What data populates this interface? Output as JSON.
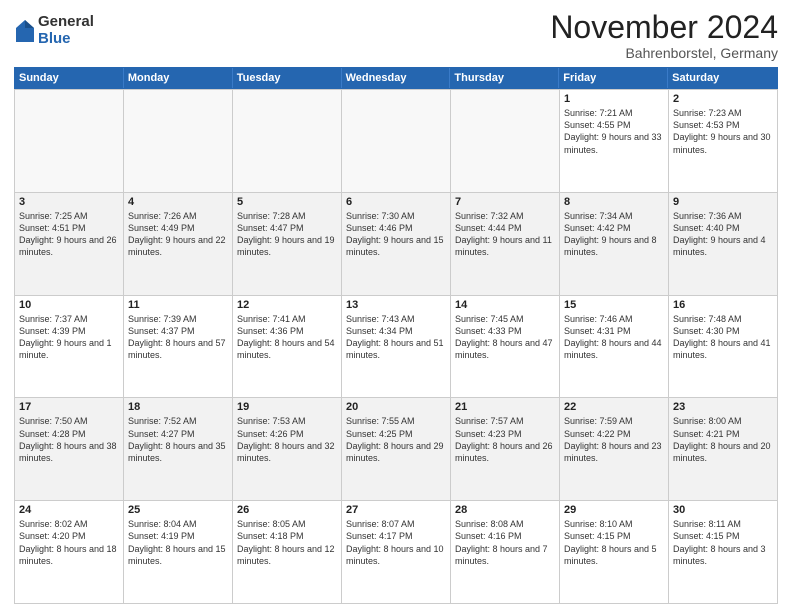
{
  "logo": {
    "general": "General",
    "blue": "Blue"
  },
  "title": "November 2024",
  "location": "Bahrenborstel, Germany",
  "header_days": [
    "Sunday",
    "Monday",
    "Tuesday",
    "Wednesday",
    "Thursday",
    "Friday",
    "Saturday"
  ],
  "weeks": [
    [
      {
        "day": "",
        "empty": true
      },
      {
        "day": "",
        "empty": true
      },
      {
        "day": "",
        "empty": true
      },
      {
        "day": "",
        "empty": true
      },
      {
        "day": "",
        "empty": true
      },
      {
        "day": "1",
        "sunrise": "Sunrise: 7:21 AM",
        "sunset": "Sunset: 4:55 PM",
        "daylight": "Daylight: 9 hours and 33 minutes."
      },
      {
        "day": "2",
        "sunrise": "Sunrise: 7:23 AM",
        "sunset": "Sunset: 4:53 PM",
        "daylight": "Daylight: 9 hours and 30 minutes."
      }
    ],
    [
      {
        "day": "3",
        "sunrise": "Sunrise: 7:25 AM",
        "sunset": "Sunset: 4:51 PM",
        "daylight": "Daylight: 9 hours and 26 minutes."
      },
      {
        "day": "4",
        "sunrise": "Sunrise: 7:26 AM",
        "sunset": "Sunset: 4:49 PM",
        "daylight": "Daylight: 9 hours and 22 minutes."
      },
      {
        "day": "5",
        "sunrise": "Sunrise: 7:28 AM",
        "sunset": "Sunset: 4:47 PM",
        "daylight": "Daylight: 9 hours and 19 minutes."
      },
      {
        "day": "6",
        "sunrise": "Sunrise: 7:30 AM",
        "sunset": "Sunset: 4:46 PM",
        "daylight": "Daylight: 9 hours and 15 minutes."
      },
      {
        "day": "7",
        "sunrise": "Sunrise: 7:32 AM",
        "sunset": "Sunset: 4:44 PM",
        "daylight": "Daylight: 9 hours and 11 minutes."
      },
      {
        "day": "8",
        "sunrise": "Sunrise: 7:34 AM",
        "sunset": "Sunset: 4:42 PM",
        "daylight": "Daylight: 9 hours and 8 minutes."
      },
      {
        "day": "9",
        "sunrise": "Sunrise: 7:36 AM",
        "sunset": "Sunset: 4:40 PM",
        "daylight": "Daylight: 9 hours and 4 minutes."
      }
    ],
    [
      {
        "day": "10",
        "sunrise": "Sunrise: 7:37 AM",
        "sunset": "Sunset: 4:39 PM",
        "daylight": "Daylight: 9 hours and 1 minute."
      },
      {
        "day": "11",
        "sunrise": "Sunrise: 7:39 AM",
        "sunset": "Sunset: 4:37 PM",
        "daylight": "Daylight: 8 hours and 57 minutes."
      },
      {
        "day": "12",
        "sunrise": "Sunrise: 7:41 AM",
        "sunset": "Sunset: 4:36 PM",
        "daylight": "Daylight: 8 hours and 54 minutes."
      },
      {
        "day": "13",
        "sunrise": "Sunrise: 7:43 AM",
        "sunset": "Sunset: 4:34 PM",
        "daylight": "Daylight: 8 hours and 51 minutes."
      },
      {
        "day": "14",
        "sunrise": "Sunrise: 7:45 AM",
        "sunset": "Sunset: 4:33 PM",
        "daylight": "Daylight: 8 hours and 47 minutes."
      },
      {
        "day": "15",
        "sunrise": "Sunrise: 7:46 AM",
        "sunset": "Sunset: 4:31 PM",
        "daylight": "Daylight: 8 hours and 44 minutes."
      },
      {
        "day": "16",
        "sunrise": "Sunrise: 7:48 AM",
        "sunset": "Sunset: 4:30 PM",
        "daylight": "Daylight: 8 hours and 41 minutes."
      }
    ],
    [
      {
        "day": "17",
        "sunrise": "Sunrise: 7:50 AM",
        "sunset": "Sunset: 4:28 PM",
        "daylight": "Daylight: 8 hours and 38 minutes."
      },
      {
        "day": "18",
        "sunrise": "Sunrise: 7:52 AM",
        "sunset": "Sunset: 4:27 PM",
        "daylight": "Daylight: 8 hours and 35 minutes."
      },
      {
        "day": "19",
        "sunrise": "Sunrise: 7:53 AM",
        "sunset": "Sunset: 4:26 PM",
        "daylight": "Daylight: 8 hours and 32 minutes."
      },
      {
        "day": "20",
        "sunrise": "Sunrise: 7:55 AM",
        "sunset": "Sunset: 4:25 PM",
        "daylight": "Daylight: 8 hours and 29 minutes."
      },
      {
        "day": "21",
        "sunrise": "Sunrise: 7:57 AM",
        "sunset": "Sunset: 4:23 PM",
        "daylight": "Daylight: 8 hours and 26 minutes."
      },
      {
        "day": "22",
        "sunrise": "Sunrise: 7:59 AM",
        "sunset": "Sunset: 4:22 PM",
        "daylight": "Daylight: 8 hours and 23 minutes."
      },
      {
        "day": "23",
        "sunrise": "Sunrise: 8:00 AM",
        "sunset": "Sunset: 4:21 PM",
        "daylight": "Daylight: 8 hours and 20 minutes."
      }
    ],
    [
      {
        "day": "24",
        "sunrise": "Sunrise: 8:02 AM",
        "sunset": "Sunset: 4:20 PM",
        "daylight": "Daylight: 8 hours and 18 minutes."
      },
      {
        "day": "25",
        "sunrise": "Sunrise: 8:04 AM",
        "sunset": "Sunset: 4:19 PM",
        "daylight": "Daylight: 8 hours and 15 minutes."
      },
      {
        "day": "26",
        "sunrise": "Sunrise: 8:05 AM",
        "sunset": "Sunset: 4:18 PM",
        "daylight": "Daylight: 8 hours and 12 minutes."
      },
      {
        "day": "27",
        "sunrise": "Sunrise: 8:07 AM",
        "sunset": "Sunset: 4:17 PM",
        "daylight": "Daylight: 8 hours and 10 minutes."
      },
      {
        "day": "28",
        "sunrise": "Sunrise: 8:08 AM",
        "sunset": "Sunset: 4:16 PM",
        "daylight": "Daylight: 8 hours and 7 minutes."
      },
      {
        "day": "29",
        "sunrise": "Sunrise: 8:10 AM",
        "sunset": "Sunset: 4:15 PM",
        "daylight": "Daylight: 8 hours and 5 minutes."
      },
      {
        "day": "30",
        "sunrise": "Sunrise: 8:11 AM",
        "sunset": "Sunset: 4:15 PM",
        "daylight": "Daylight: 8 hours and 3 minutes."
      }
    ]
  ]
}
